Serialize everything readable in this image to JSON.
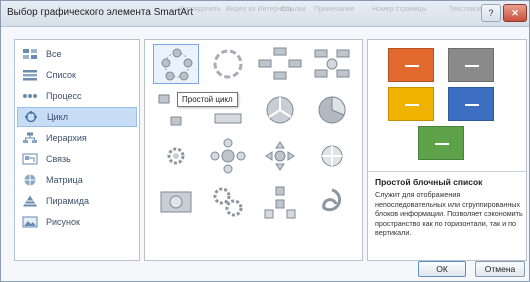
{
  "window": {
    "title": "Выбор графического элемента SmartArt",
    "bg_ribbon": [
      "Упорядочить",
      "Видео из Интернета",
      "Ссылки",
      "Примечание",
      "Номер страницы",
      "Текстовое поле"
    ],
    "help_label": "?",
    "close_label": "✕"
  },
  "categories": [
    {
      "label": "Все",
      "icon": "all-icon",
      "selected": false
    },
    {
      "label": "Список",
      "icon": "list-icon",
      "selected": false
    },
    {
      "label": "Процесс",
      "icon": "process-icon",
      "selected": false
    },
    {
      "label": "Цикл",
      "icon": "cycle-icon",
      "selected": true
    },
    {
      "label": "Иерархия",
      "icon": "hierarchy-icon",
      "selected": false
    },
    {
      "label": "Связь",
      "icon": "relationship-icon",
      "selected": false
    },
    {
      "label": "Матрица",
      "icon": "matrix-icon",
      "selected": false
    },
    {
      "label": "Пирамида",
      "icon": "pyramid-icon",
      "selected": false
    },
    {
      "label": "Рисунок",
      "icon": "picture-icon",
      "selected": false
    }
  ],
  "layouts_tooltip": "Простой цикл",
  "preview": {
    "title": "Простой блочный список",
    "description": "Служит для отображения непоследовательных или сгруппированных блоков информации. Позволяет сэкономить пространство как по горизонтали, так и по вертикали.",
    "colors": [
      "#e2692e",
      "#8a8a8a",
      "#f0b400",
      "#3c6ec2",
      "#5ea34a"
    ]
  },
  "buttons": {
    "ok": "ОК",
    "cancel": "Отмена"
  }
}
